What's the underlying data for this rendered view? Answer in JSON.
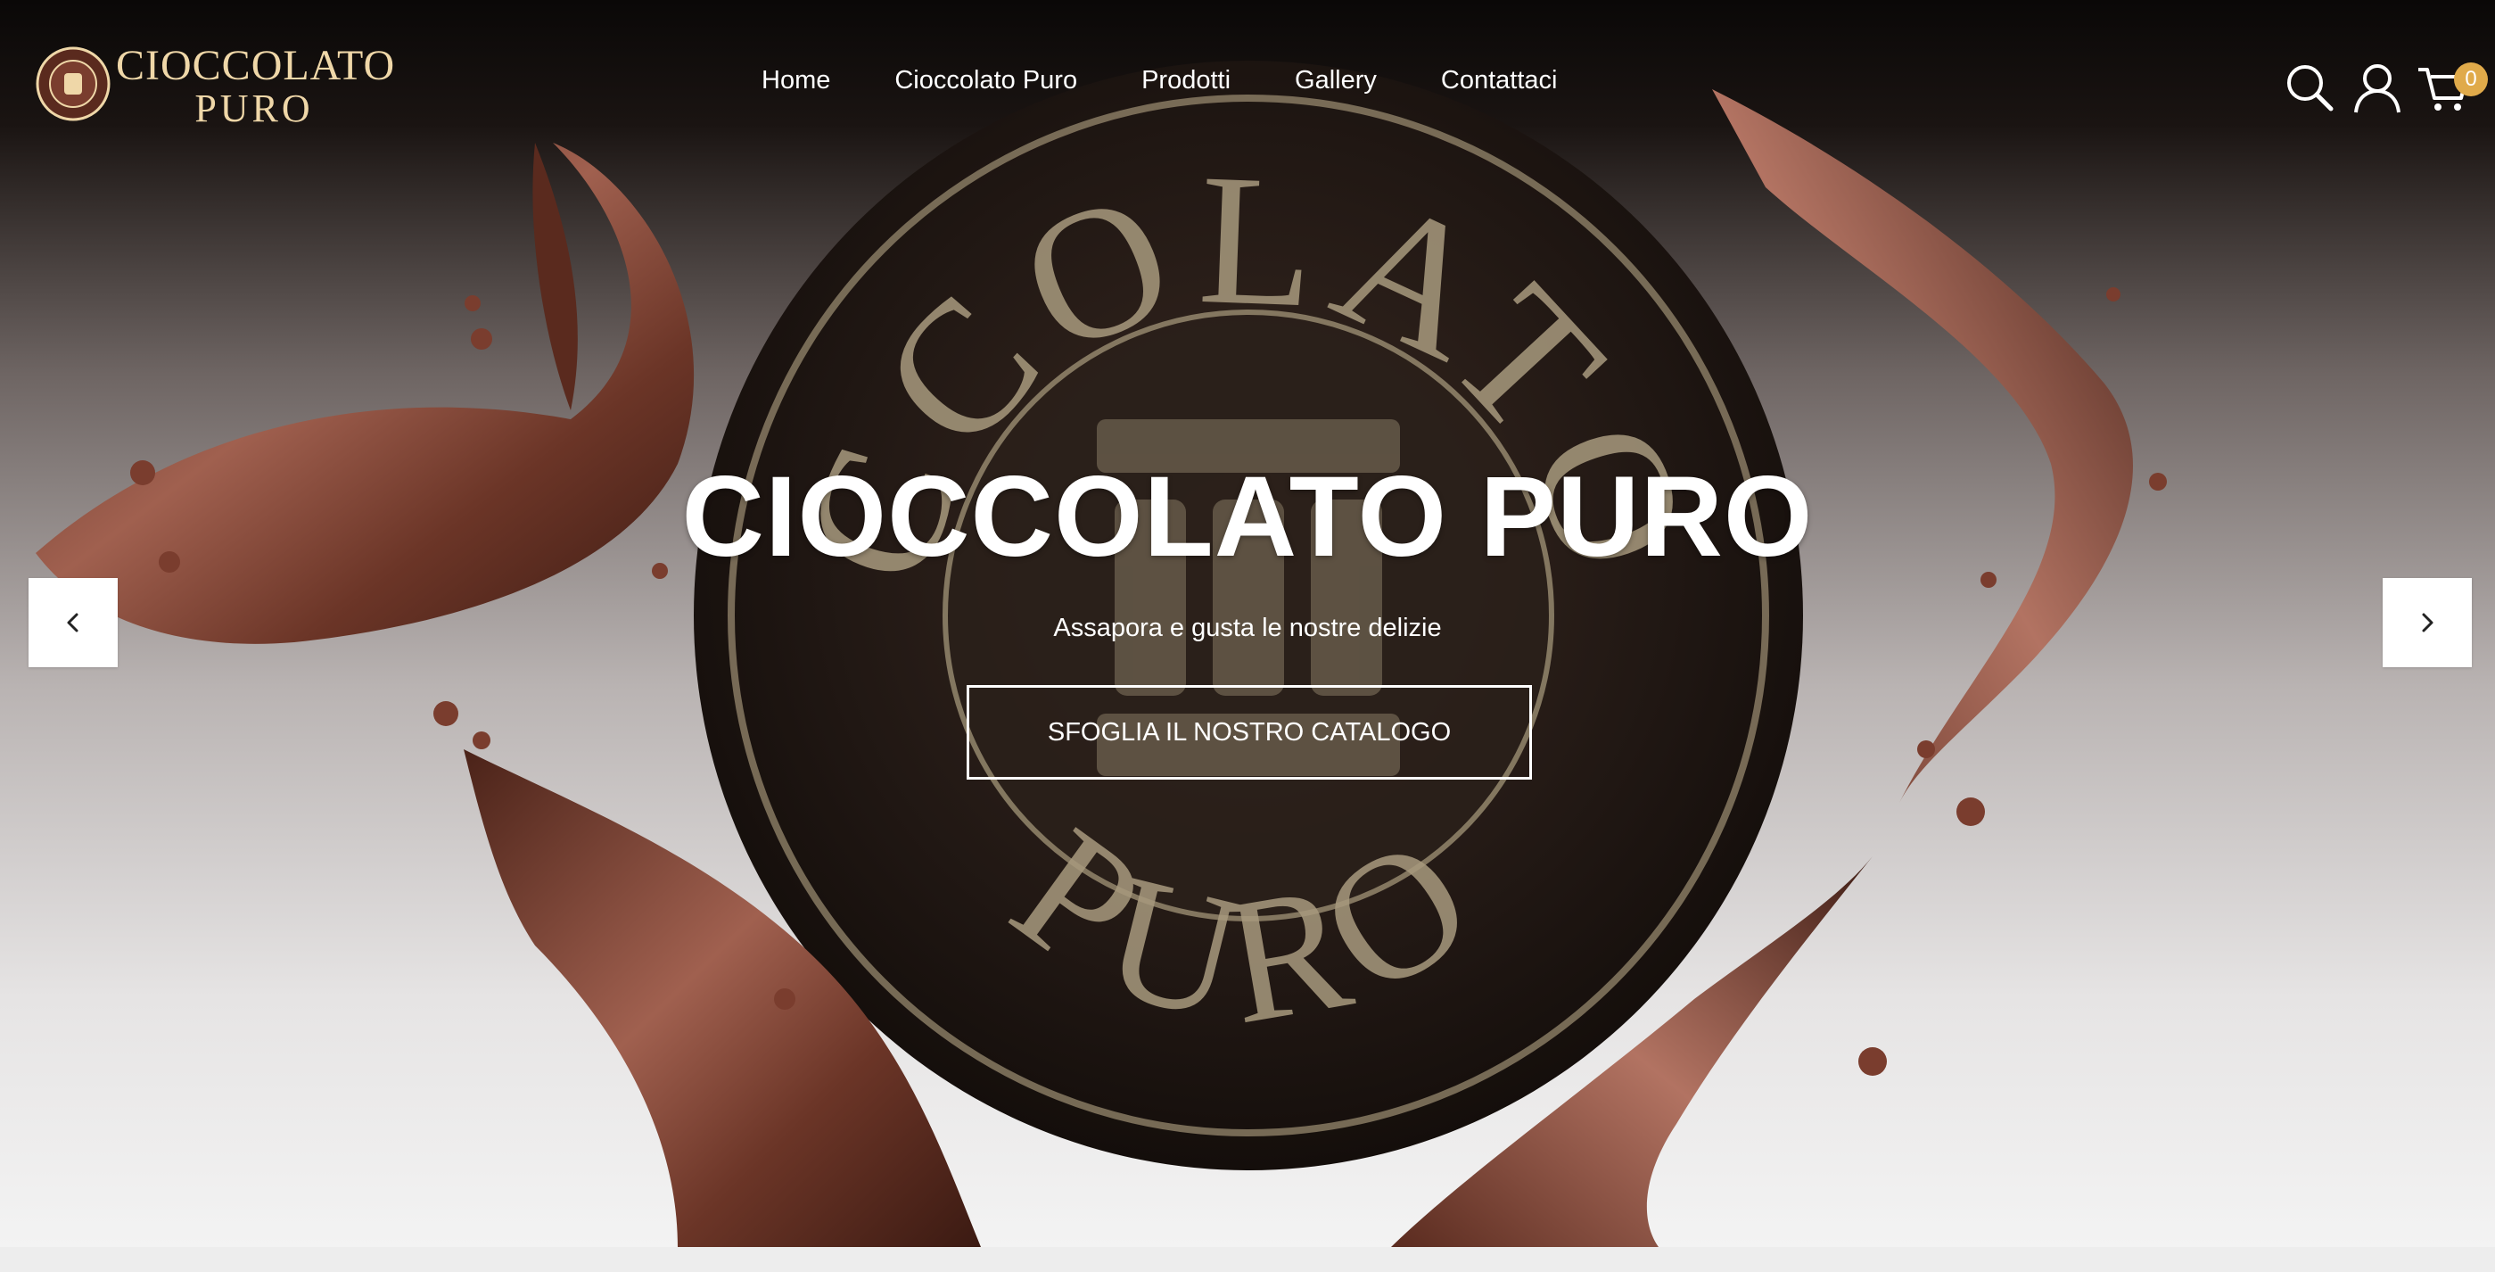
{
  "brand": {
    "logo_line1": "CIOCCOLATO",
    "logo_line2": "PURO",
    "logo_color": "#efd7a8"
  },
  "nav": {
    "items": [
      {
        "label": "Home"
      },
      {
        "label": "Cioccolato Puro"
      },
      {
        "label": "Prodotti"
      },
      {
        "label": "Gallery"
      },
      {
        "label": "Contattaci"
      }
    ]
  },
  "header_icons": {
    "search": "search-icon",
    "account": "user-icon",
    "cart": "cart-icon",
    "cart_count": "0",
    "badge_color": "#e0aa4a"
  },
  "hero": {
    "title": "CIOCCOLATO PURO",
    "subtitle": "Assapora e gusta le nostre delizie",
    "cta_label": "SFOGLIA IL NOSTRO CATALOGO",
    "seal_text_top": "CCOLATO",
    "seal_text_bottom": "PURO",
    "prev_icon": "chevron-left-icon",
    "next_icon": "chevron-right-icon"
  },
  "colors": {
    "chocolate": "#6b3527",
    "chocolate_light": "#a8675a",
    "seal_dark": "#221915",
    "seal_gold": "#b3a58a"
  }
}
